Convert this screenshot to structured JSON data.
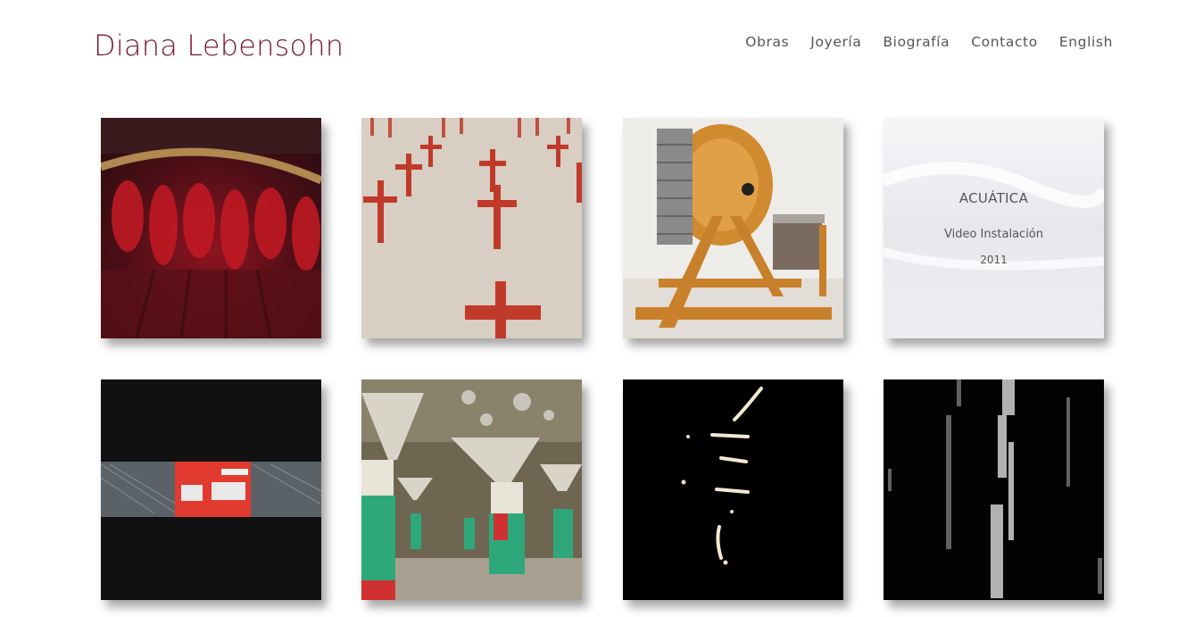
{
  "header": {
    "title": "Diana Lebensohn",
    "nav": [
      "Obras",
      "Joyería",
      "Biografía",
      "Contacto",
      "English"
    ]
  },
  "works": [
    {
      "thumb": "red-feather-headdress"
    },
    {
      "thumb": "red-crosses-on-sand"
    },
    {
      "thumb": "wooden-wheel-machine"
    },
    {
      "thumb": "white-water-waves",
      "title": "ACUÁTICA",
      "type": "Video Instalación",
      "year": "2011"
    },
    {
      "thumb": "red-train-car"
    },
    {
      "thumb": "abandoned-columns-hall"
    },
    {
      "thumb": "light-streaks-on-black"
    },
    {
      "thumb": "grey-streaks-on-black"
    }
  ],
  "colors": {
    "title": "#7a1a2a",
    "nav": "#555555"
  }
}
